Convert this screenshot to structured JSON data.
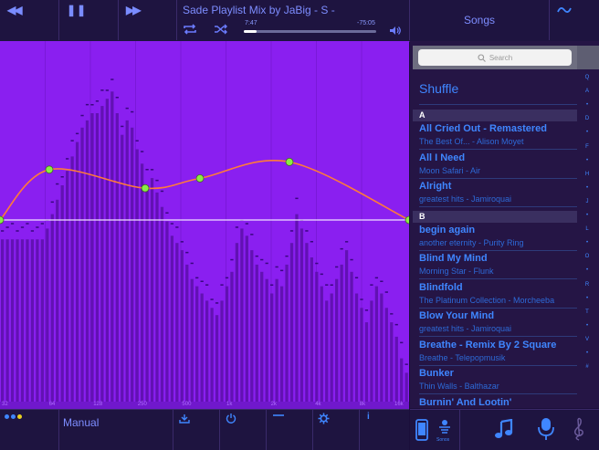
{
  "colors": {
    "accent": "#3f86ff",
    "eq_bg": "#8a1ff0",
    "curve": "#ff7a3a",
    "node": "#88ee44",
    "panel": "#251545"
  },
  "transport": {
    "rewind_icon": "rewind-icon",
    "pause_icon": "pause-icon",
    "forward_icon": "fast-forward-icon"
  },
  "now_playing": {
    "title": "Sade Playlist Mix by JaBig - S -",
    "elapsed": "7:47",
    "remaining": "-75:05",
    "progress_fraction": 0.094
  },
  "header": {
    "songs_label": "Songs"
  },
  "search": {
    "placeholder": "Search"
  },
  "library": {
    "shuffle_label": "Shuffle",
    "sections": [
      {
        "letter": "A",
        "songs": [
          {
            "title": "All Cried Out - Remastered",
            "subtitle": "The Best Of... - Alison Moyet"
          },
          {
            "title": "All I Need",
            "subtitle": "Moon Safari - Air"
          },
          {
            "title": "Alright",
            "subtitle": "greatest hits - Jamiroquai"
          }
        ]
      },
      {
        "letter": "B",
        "songs": [
          {
            "title": "begin again",
            "subtitle": "another eternity - Purity Ring"
          },
          {
            "title": "Blind My Mind",
            "subtitle": "Morning Star - Flunk"
          },
          {
            "title": "Blindfold",
            "subtitle": "The Platinum Collection - Morcheeba"
          },
          {
            "title": "Blow Your Mind",
            "subtitle": "greatest hits - Jamiroquai"
          },
          {
            "title": "Breathe - Remix By 2 Square",
            "subtitle": "Breathe - Telepopmusik"
          },
          {
            "title": "Bunker",
            "subtitle": "Thin Walls - Balthazar"
          },
          {
            "title": "Burnin' And Lootin'",
            "subtitle": ""
          }
        ]
      }
    ],
    "index_letters": [
      "Q",
      "A",
      "•",
      "D",
      "•",
      "F",
      "•",
      "H",
      "•",
      "J",
      "•",
      "L",
      "•",
      "O",
      "•",
      "R",
      "•",
      "T",
      "•",
      "V",
      "•",
      "#"
    ]
  },
  "eq": {
    "freq_labels": [
      "32",
      "64",
      "128",
      "250",
      "500",
      "1k",
      "2k",
      "4k",
      "8k",
      "16k"
    ],
    "node_levels": [
      0,
      0.46,
      0.29,
      0.38,
      0.53,
      0
    ],
    "spectrum_levels": [
      0.45,
      0.45,
      0.45,
      0.45,
      0.45,
      0.45,
      0.45,
      0.45,
      0.45,
      0.48,
      0.52,
      0.56,
      0.6,
      0.64,
      0.68,
      0.72,
      0.76,
      0.78,
      0.8,
      0.8,
      0.82,
      0.84,
      0.86,
      0.8,
      0.74,
      0.78,
      0.76,
      0.7,
      0.66,
      0.6,
      0.62,
      0.58,
      0.54,
      0.5,
      0.46,
      0.44,
      0.42,
      0.38,
      0.34,
      0.32,
      0.3,
      0.28,
      0.26,
      0.24,
      0.28,
      0.32,
      0.36,
      0.44,
      0.48,
      0.46,
      0.42,
      0.38,
      0.36,
      0.34,
      0.3,
      0.34,
      0.32,
      0.38,
      0.44,
      0.52,
      0.48,
      0.44,
      0.4,
      0.36,
      0.32,
      0.28,
      0.3,
      0.34,
      0.38,
      0.42,
      0.36,
      0.3,
      0.26,
      0.22,
      0.28,
      0.32,
      0.3,
      0.26,
      0.22,
      0.18,
      0.12,
      0.08
    ]
  },
  "toolbar": {
    "mode_label": "Manual",
    "share_icon": "share-icon",
    "power_icon": "power-icon",
    "flat_icon": "flat-line-icon",
    "settings_icon": "gear-icon",
    "info_icon": "info-icon",
    "info_label": "i"
  },
  "right_toolbar": {
    "connected_label": "Sonos",
    "music_icon": "music-note-icon",
    "mic_icon": "microphone-icon",
    "treble_icon": "treble-clef-icon"
  }
}
